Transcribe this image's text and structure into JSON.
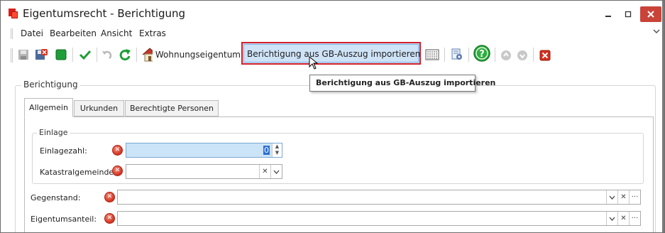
{
  "window": {
    "title": "Eigentumsrecht - Berichtigung",
    "controls": {
      "minimize": "_",
      "maximize": "□",
      "close": "✕"
    }
  },
  "menu": {
    "items": [
      "Datei",
      "Bearbeiten",
      "Ansicht",
      "Extras"
    ],
    "overflow_icon": "chevron-down-icon"
  },
  "toolbar": {
    "wohnungseigentum_label": "Wohnungseigentum",
    "import_label": "Berichtigung aus GB-Auszug importieren",
    "accent_highlight": "#d0202a"
  },
  "tooltip": {
    "text": "Berichtigung aus GB-Auszug importieren"
  },
  "group": {
    "title": "Berichtigung"
  },
  "tabs": [
    {
      "label": "Allgemein",
      "active": true
    },
    {
      "label": "Urkunden",
      "active": false
    },
    {
      "label": "Berechtigte Personen",
      "active": false
    }
  ],
  "einlage": {
    "title": "Einlage",
    "einlagezahl_label": "Einlagezahl:",
    "einlagezahl_value": "0",
    "katastralgemeinde_label": "Katastralgemeinde:",
    "katastralgemeinde_value": ""
  },
  "fields": {
    "gegenstand_label": "Gegenstand:",
    "gegenstand_value": "",
    "eigentumsanteil_label": "Eigentumsanteil:",
    "eigentumsanteil_value": ""
  },
  "colors": {
    "error": "#d2301e",
    "focus": "#cce4f7"
  }
}
